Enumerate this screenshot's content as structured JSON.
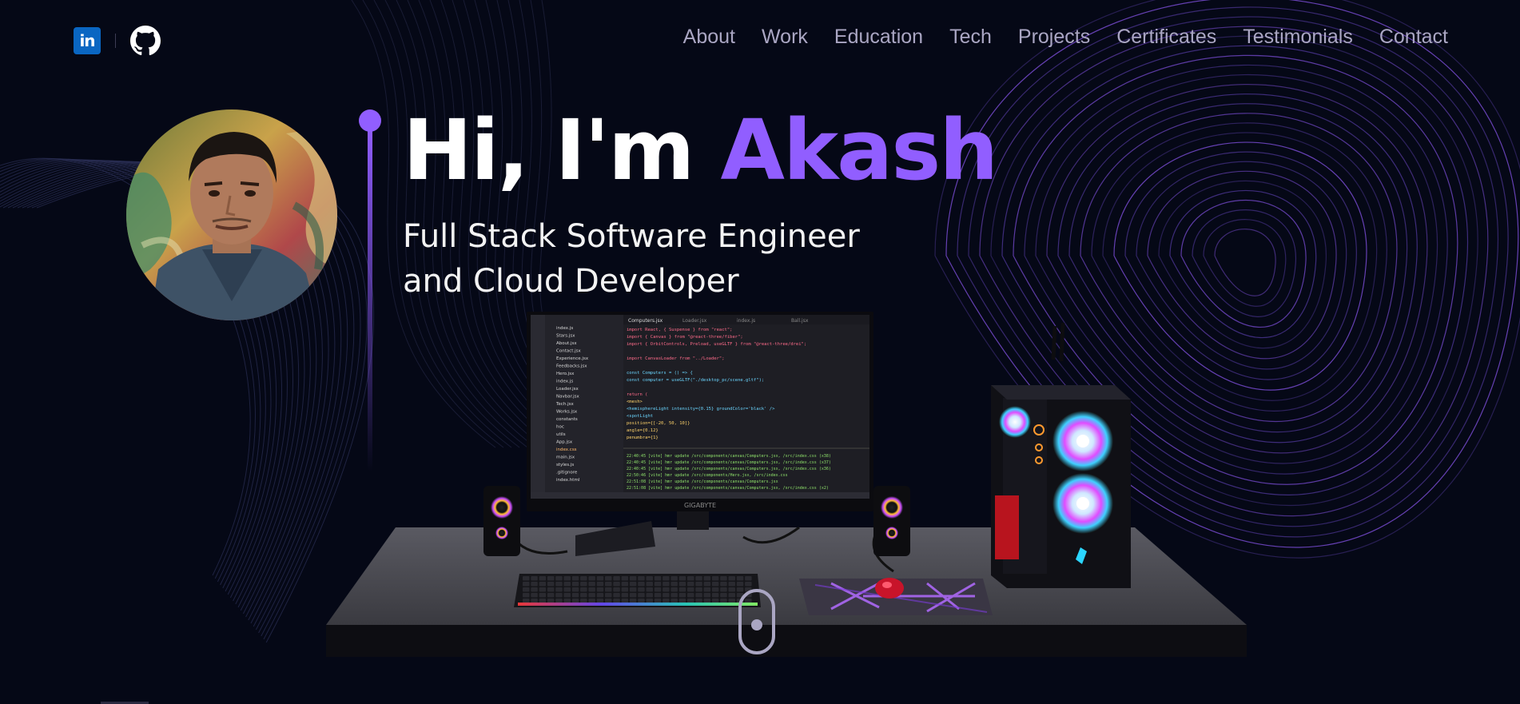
{
  "social": {
    "linkedin_label": "in"
  },
  "nav": {
    "items": [
      {
        "label": "About"
      },
      {
        "label": "Work"
      },
      {
        "label": "Education"
      },
      {
        "label": "Tech"
      },
      {
        "label": "Projects"
      },
      {
        "label": "Certificates"
      },
      {
        "label": "Testimonials"
      },
      {
        "label": "Contact"
      }
    ]
  },
  "hero": {
    "greeting": "Hi, I'm ",
    "name": "Akash",
    "subtitle_line1": "Full Stack Software Engineer",
    "subtitle_line2": "and Cloud Developer"
  },
  "monitor": {
    "brand": "GIGABYTE",
    "tabs": [
      "Computers.jsx",
      "Loader.jsx",
      "index.js",
      "Ball.jsx"
    ],
    "code_lines": [
      "import React, { Suspense } from \"react\";",
      "import { Canvas } from \"@react-three/fiber\";",
      "import { OrbitControls, Preload, useGLTF } from \"@react-three/drei\";",
      "",
      "import CanvasLoader from \"../Loader\";",
      "",
      "const Computers = () => {",
      "  const computer = useGLTF(\"./desktop_pc/scene.gltf\");",
      "",
      "  return (",
      "    <mesh>",
      "      <hemisphereLight intensity={0.15} groundColor='black' />",
      "      <spotLight",
      "        position={[-20, 50, 10]}",
      "        angle={0.12}",
      "        penumbra={1}"
    ],
    "files": [
      "index.js",
      "Stars.jsx",
      "About.jsx",
      "Contact.jsx",
      "Experience.jsx",
      "Feedbacks.jsx",
      "Hero.jsx",
      "index.js",
      "Loader.jsx",
      "Navbar.jsx",
      "Tech.jsx",
      "Works.jsx",
      "constants",
      "hoc",
      "utils",
      "App.jsx",
      "index.css",
      "main.jsx",
      "styles.js",
      ".gitignore",
      "index.html"
    ],
    "terminal_lines": [
      "22:40:45 [vite] hmr update /src/components/canvas/Computers.jsx, /src/index.css (x38)",
      "22:40:45 [vite] hmr update /src/components/canvas/Computers.jsx, /src/index.css (x37)",
      "22:40:45 [vite] hmr update /src/components/canvas/Computers.jsx, /src/index.css (x36)",
      "22:50:46 [vite] hmr update /src/components/Hero.jsx, /src/index.css",
      "22:51:08 [vite] hmr update /src/components/canvas/Computers.jsx",
      "22:51:08 [vite] hmr update /src/components/canvas/Computers.jsx, /src/index.css (x2)",
      "22:51:09 [vite] hmr update /src/components/canvas/Computers.jsx, /src/index.css (x3)"
    ]
  },
  "colors": {
    "background": "#050816",
    "accent": "#915eff",
    "nav_text": "#aaa6c3",
    "white": "#ffffff",
    "linkedin": "#0a66c2"
  },
  "icons": {
    "linkedin": "linkedin-icon",
    "github": "github-icon",
    "scroll": "mouse-scroll-icon"
  }
}
